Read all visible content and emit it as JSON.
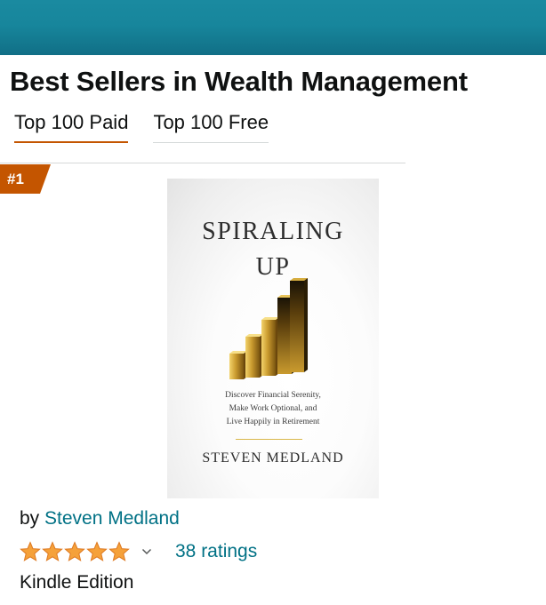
{
  "page": {
    "title": "Best Sellers in Wealth Management",
    "accent_color": "#c45500",
    "link_color": "#007185",
    "header_color": "#17869c"
  },
  "tabs": [
    {
      "label": "Top 100 Paid",
      "active": true
    },
    {
      "label": "Top 100 Free",
      "active": false
    }
  ],
  "product": {
    "rank": "#1",
    "cover": {
      "title_line_1": "SPIRALING",
      "title_line_2": "UP",
      "subtitle_lines": [
        "Discover Financial Serenity,",
        "Make Work Optional, and",
        "Live Happily in Retirement"
      ],
      "author": "STEVEN MEDLAND",
      "graphic": "gold-bar-chart-rising"
    },
    "by_prefix": "by",
    "author": "Steven Medland",
    "rating_stars": 5,
    "rating_icon": "star-icon",
    "ratings_text": "38 ratings",
    "edition": "Kindle Edition"
  }
}
